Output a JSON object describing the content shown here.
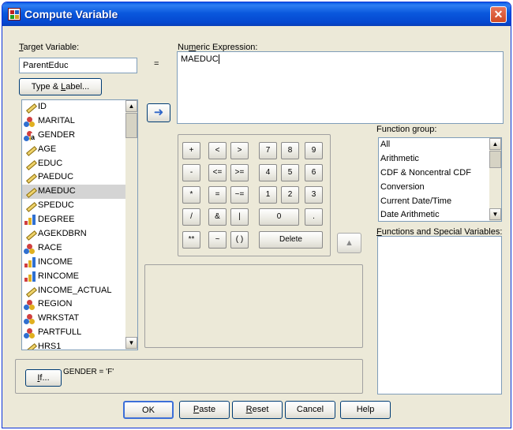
{
  "window": {
    "title": "Compute Variable",
    "close_glyph": "✕"
  },
  "target": {
    "label_u": "T",
    "label_rest": "arget Variable:",
    "value": "ParentEduc",
    "equals": "="
  },
  "type_label_button": {
    "pre": "Type & ",
    "u": "L",
    "post": "abel..."
  },
  "variables": [
    {
      "name": "ID",
      "icon": "scale-ruler-icon"
    },
    {
      "name": "MARITAL",
      "icon": "nominal-icon"
    },
    {
      "name": "GENDER",
      "icon": "nominal-string-icon"
    },
    {
      "name": "AGE",
      "icon": "scale-ruler-icon"
    },
    {
      "name": "EDUC",
      "icon": "scale-ruler-icon"
    },
    {
      "name": "PAEDUC",
      "icon": "scale-ruler-icon"
    },
    {
      "name": "MAEDUC",
      "icon": "scale-ruler-icon",
      "selected": true
    },
    {
      "name": "SPEDUC",
      "icon": "scale-ruler-icon"
    },
    {
      "name": "DEGREE",
      "icon": "ordinal-bar-icon"
    },
    {
      "name": "AGEKDBRN",
      "icon": "scale-ruler-icon"
    },
    {
      "name": "RACE",
      "icon": "nominal-icon"
    },
    {
      "name": "INCOME",
      "icon": "ordinal-bar-icon"
    },
    {
      "name": "RINCOME",
      "icon": "ordinal-bar-icon"
    },
    {
      "name": "INCOME_ACTUAL",
      "icon": "scale-ruler-icon"
    },
    {
      "name": "REGION",
      "icon": "nominal-icon"
    },
    {
      "name": "WRKSTAT",
      "icon": "nominal-icon"
    },
    {
      "name": "PARTFULL",
      "icon": "nominal-icon"
    },
    {
      "name": "HRS1",
      "icon": "scale-ruler-icon"
    }
  ],
  "expression": {
    "label_pre": "Nu",
    "label_u": "m",
    "label_post": "eric Expression:",
    "value": "MAEDUC"
  },
  "keypad": {
    "plus": "+",
    "lt": "<",
    "gt": ">",
    "seven": "7",
    "eight": "8",
    "nine": "9",
    "minus": "-",
    "le": "<=",
    "ge": ">=",
    "four": "4",
    "five": "5",
    "six": "6",
    "times": "*",
    "eq": "=",
    "ne": "~=",
    "one": "1",
    "two": "2",
    "three": "3",
    "divide": "/",
    "and": "&",
    "or": "|",
    "zero": "0",
    "dot": ".",
    "power": "**",
    "not": "~",
    "parens": "( )",
    "delete": "Delete"
  },
  "function_group": {
    "label_pre": "Function ",
    "label_u": "g",
    "label_post": "roup:",
    "items": [
      "All",
      "Arithmetic",
      "CDF & Noncentral CDF",
      "Conversion",
      "Current Date/Time",
      "Date Arithmetic"
    ]
  },
  "functions_vars": {
    "label_u": "F",
    "label_rest": "unctions and Special Variables:"
  },
  "if_clause": {
    "button_u": "I",
    "button_rest": "f...",
    "condition": "GENDER = 'F'"
  },
  "buttons": {
    "ok": "OK",
    "paste_u": "P",
    "paste_rest": "aste",
    "reset_u": "R",
    "reset_rest": "eset",
    "cancel": "Cancel",
    "help": "Help"
  },
  "icons": {
    "move_arrow": "➜",
    "up_arrow": "▲",
    "scroll_up": "▲",
    "scroll_down": "▼"
  },
  "colors": {
    "titlebar": "#0a58dd",
    "selection": "#d4d4d4",
    "move_arrow": "#2f66c8"
  }
}
